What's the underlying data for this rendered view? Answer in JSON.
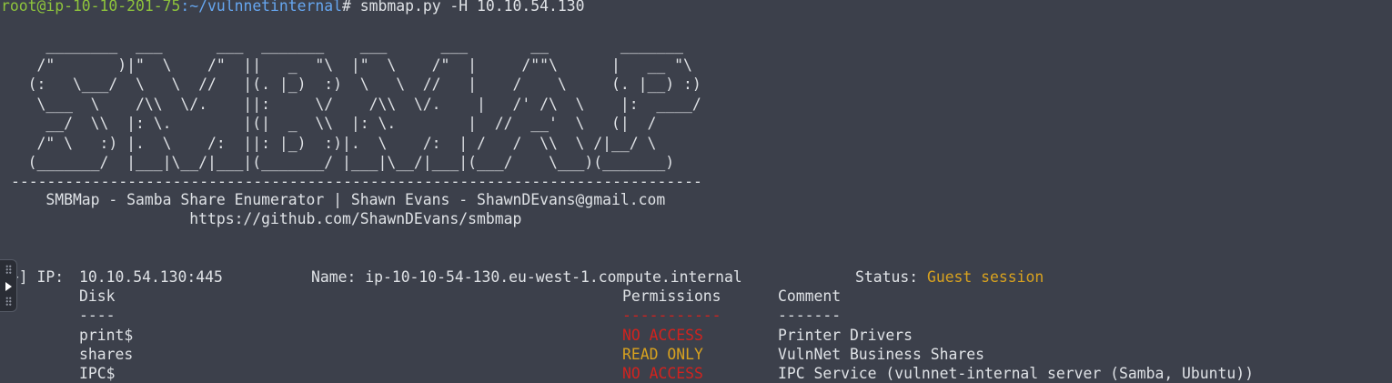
{
  "prompt": {
    "user_host": "root@ip-10-10-201-75",
    "path": ":~/vulnnetinternal",
    "symbol": "# ",
    "command": "smbmap.py -H 10.10.54.130"
  },
  "banner": {
    "ascii_lines": [
      "     ________  ___      ___  _______    ___      ___       __        _______",
      "    /\"       )|\"  \\    /\"  ||   _  \"\\  |\"  \\    /\"  |     /\"\"\\      |   __ \"\\",
      "   (:   \\___/  \\   \\  //   |(. |_)  :)  \\   \\  //   |    /    \\     (. |__) :)",
      "    \\___  \\    /\\\\  \\/.    ||:     \\/    /\\\\  \\/.    |   /' /\\  \\    |:  ____/",
      "     __/  \\\\  |: \\.        |(|  _  \\\\  |: \\.        |  //  __'  \\   (|  /",
      "    /\" \\   :) |.  \\    /:  ||: |_)  :)|.  \\    /:  | /   /  \\\\  \\ /|__/ \\",
      "   (_______/  |___|\\__/|___|(_______/ |___|\\__/|___|(___/    \\___)(_______)"
    ],
    "divider": "-----------------------------------------------------------------------------",
    "credit": "     SMBMap - Samba Share Enumerator | Shawn Evans - ShawnDEvans@gmail.com",
    "url": "                     https://github.com/ShawnDEvans/smbmap"
  },
  "scan": {
    "prefix": "[+] IP: ",
    "ip": "10.10.54.130:445",
    "name_label": "Name: ",
    "name": "ip-10-10-54-130.eu-west-1.compute.internal",
    "status_label": "Status: ",
    "status": "Guest session"
  },
  "table": {
    "headers": {
      "disk": "Disk",
      "permissions": "Permissions",
      "comment": "Comment"
    },
    "underlines": {
      "disk": "----",
      "permissions": "-----------",
      "comment": "-------"
    },
    "rows": [
      {
        "disk": "print$",
        "permissions": "NO ACCESS",
        "comment": "Printer Drivers"
      },
      {
        "disk": "shares",
        "permissions": "READ ONLY",
        "comment": "VulnNet Business Shares"
      },
      {
        "disk": "IPC$",
        "permissions": "NO ACCESS",
        "comment": "IPC Service (vulnnet-internal server (Samba, Ubuntu))"
      }
    ]
  },
  "colors": {
    "background": "#3c404b",
    "text": "#dfe2e6",
    "prompt_user": "#8ec43c",
    "prompt_path": "#66a6f0",
    "guest_status": "#d8a21f",
    "no_access": "#d1231f",
    "read_only": "#d8a21f"
  },
  "icons": {
    "side_handle": "grip-handle-icon",
    "play": "play-icon"
  }
}
